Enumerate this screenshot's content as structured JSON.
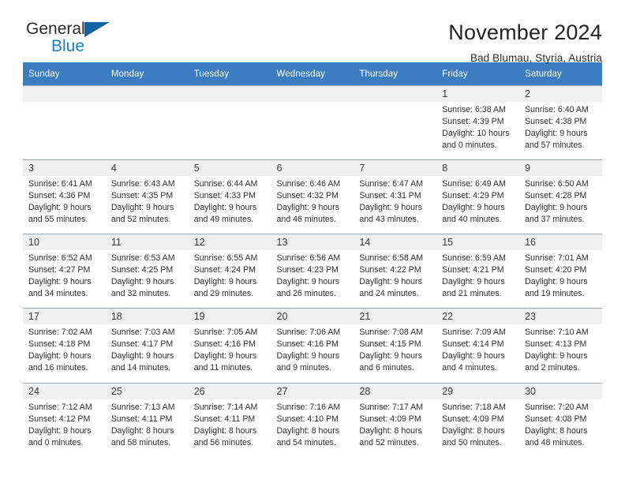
{
  "brand": {
    "name_part1": "General",
    "name_part2": "Blue",
    "triangle_color": "#1464a5"
  },
  "header": {
    "title": "November 2024",
    "subtitle": "Bad Blumau, Styria, Austria"
  },
  "theme": {
    "header_bg": "#3b7dc0",
    "daynum_bg": "#f0f0f0",
    "cell_bg": "#ffffff",
    "border": "#9aa5ad",
    "text": "#2e2e2e"
  },
  "weekdays": [
    "Sunday",
    "Monday",
    "Tuesday",
    "Wednesday",
    "Thursday",
    "Friday",
    "Saturday"
  ],
  "weeks": [
    [
      {
        "day": "",
        "lines": []
      },
      {
        "day": "",
        "lines": []
      },
      {
        "day": "",
        "lines": []
      },
      {
        "day": "",
        "lines": []
      },
      {
        "day": "",
        "lines": []
      },
      {
        "day": "1",
        "lines": [
          "Sunrise: 6:38 AM",
          "Sunset: 4:39 PM",
          "Daylight: 10 hours",
          "and 0 minutes."
        ]
      },
      {
        "day": "2",
        "lines": [
          "Sunrise: 6:40 AM",
          "Sunset: 4:38 PM",
          "Daylight: 9 hours",
          "and 57 minutes."
        ]
      }
    ],
    [
      {
        "day": "3",
        "lines": [
          "Sunrise: 6:41 AM",
          "Sunset: 4:36 PM",
          "Daylight: 9 hours",
          "and 55 minutes."
        ]
      },
      {
        "day": "4",
        "lines": [
          "Sunrise: 6:43 AM",
          "Sunset: 4:35 PM",
          "Daylight: 9 hours",
          "and 52 minutes."
        ]
      },
      {
        "day": "5",
        "lines": [
          "Sunrise: 6:44 AM",
          "Sunset: 4:33 PM",
          "Daylight: 9 hours",
          "and 49 minutes."
        ]
      },
      {
        "day": "6",
        "lines": [
          "Sunrise: 6:46 AM",
          "Sunset: 4:32 PM",
          "Daylight: 9 hours",
          "and 46 minutes."
        ]
      },
      {
        "day": "7",
        "lines": [
          "Sunrise: 6:47 AM",
          "Sunset: 4:31 PM",
          "Daylight: 9 hours",
          "and 43 minutes."
        ]
      },
      {
        "day": "8",
        "lines": [
          "Sunrise: 6:49 AM",
          "Sunset: 4:29 PM",
          "Daylight: 9 hours",
          "and 40 minutes."
        ]
      },
      {
        "day": "9",
        "lines": [
          "Sunrise: 6:50 AM",
          "Sunset: 4:28 PM",
          "Daylight: 9 hours",
          "and 37 minutes."
        ]
      }
    ],
    [
      {
        "day": "10",
        "lines": [
          "Sunrise: 6:52 AM",
          "Sunset: 4:27 PM",
          "Daylight: 9 hours",
          "and 34 minutes."
        ]
      },
      {
        "day": "11",
        "lines": [
          "Sunrise: 6:53 AM",
          "Sunset: 4:25 PM",
          "Daylight: 9 hours",
          "and 32 minutes."
        ]
      },
      {
        "day": "12",
        "lines": [
          "Sunrise: 6:55 AM",
          "Sunset: 4:24 PM",
          "Daylight: 9 hours",
          "and 29 minutes."
        ]
      },
      {
        "day": "13",
        "lines": [
          "Sunrise: 6:56 AM",
          "Sunset: 4:23 PM",
          "Daylight: 9 hours",
          "and 26 minutes."
        ]
      },
      {
        "day": "14",
        "lines": [
          "Sunrise: 6:58 AM",
          "Sunset: 4:22 PM",
          "Daylight: 9 hours",
          "and 24 minutes."
        ]
      },
      {
        "day": "15",
        "lines": [
          "Sunrise: 6:59 AM",
          "Sunset: 4:21 PM",
          "Daylight: 9 hours",
          "and 21 minutes."
        ]
      },
      {
        "day": "16",
        "lines": [
          "Sunrise: 7:01 AM",
          "Sunset: 4:20 PM",
          "Daylight: 9 hours",
          "and 19 minutes."
        ]
      }
    ],
    [
      {
        "day": "17",
        "lines": [
          "Sunrise: 7:02 AM",
          "Sunset: 4:18 PM",
          "Daylight: 9 hours",
          "and 16 minutes."
        ]
      },
      {
        "day": "18",
        "lines": [
          "Sunrise: 7:03 AM",
          "Sunset: 4:17 PM",
          "Daylight: 9 hours",
          "and 14 minutes."
        ]
      },
      {
        "day": "19",
        "lines": [
          "Sunrise: 7:05 AM",
          "Sunset: 4:16 PM",
          "Daylight: 9 hours",
          "and 11 minutes."
        ]
      },
      {
        "day": "20",
        "lines": [
          "Sunrise: 7:06 AM",
          "Sunset: 4:16 PM",
          "Daylight: 9 hours",
          "and 9 minutes."
        ]
      },
      {
        "day": "21",
        "lines": [
          "Sunrise: 7:08 AM",
          "Sunset: 4:15 PM",
          "Daylight: 9 hours",
          "and 6 minutes."
        ]
      },
      {
        "day": "22",
        "lines": [
          "Sunrise: 7:09 AM",
          "Sunset: 4:14 PM",
          "Daylight: 9 hours",
          "and 4 minutes."
        ]
      },
      {
        "day": "23",
        "lines": [
          "Sunrise: 7:10 AM",
          "Sunset: 4:13 PM",
          "Daylight: 9 hours",
          "and 2 minutes."
        ]
      }
    ],
    [
      {
        "day": "24",
        "lines": [
          "Sunrise: 7:12 AM",
          "Sunset: 4:12 PM",
          "Daylight: 9 hours",
          "and 0 minutes."
        ]
      },
      {
        "day": "25",
        "lines": [
          "Sunrise: 7:13 AM",
          "Sunset: 4:11 PM",
          "Daylight: 8 hours",
          "and 58 minutes."
        ]
      },
      {
        "day": "26",
        "lines": [
          "Sunrise: 7:14 AM",
          "Sunset: 4:11 PM",
          "Daylight: 8 hours",
          "and 56 minutes."
        ]
      },
      {
        "day": "27",
        "lines": [
          "Sunrise: 7:16 AM",
          "Sunset: 4:10 PM",
          "Daylight: 8 hours",
          "and 54 minutes."
        ]
      },
      {
        "day": "28",
        "lines": [
          "Sunrise: 7:17 AM",
          "Sunset: 4:09 PM",
          "Daylight: 8 hours",
          "and 52 minutes."
        ]
      },
      {
        "day": "29",
        "lines": [
          "Sunrise: 7:18 AM",
          "Sunset: 4:09 PM",
          "Daylight: 8 hours",
          "and 50 minutes."
        ]
      },
      {
        "day": "30",
        "lines": [
          "Sunrise: 7:20 AM",
          "Sunset: 4:08 PM",
          "Daylight: 8 hours",
          "and 48 minutes."
        ]
      }
    ]
  ]
}
